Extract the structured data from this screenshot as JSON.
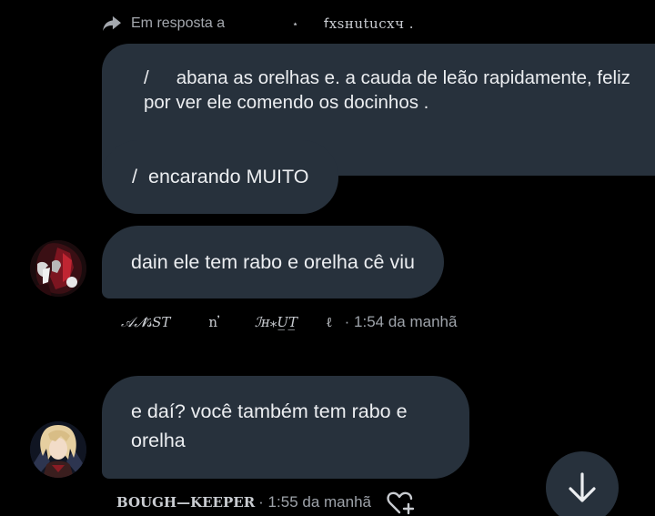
{
  "reply_header": {
    "label": "Em resposta a",
    "star": "⋆",
    "name": "ꬵxsʜutucxч ."
  },
  "messages": [
    {
      "slash": "/",
      "line1": "abana as orelhas e. a cauda de leão rapidamente, feliz",
      "line2": "por ver ele comendo os docinhos ."
    },
    {
      "slash": "/",
      "text": "encarando MUITO"
    },
    {
      "text": "dain ele tem rabo e orelha cê viu"
    },
    {
      "line1": "e daí? você também tem rabo e",
      "line2": "orelha"
    }
  ],
  "meta_1": {
    "seg1": "𝒜𝓝̈𝓈ST",
    "seg2": "n ̓",
    "seg3": "ℐʜ⁎U̲T̲",
    "seg4": "ℓ",
    "time": " · 1:54 da manhã"
  },
  "meta_2": {
    "name": "BOUGH—KEEPER",
    "time": " · 1:55 da manhã"
  },
  "icons": {
    "reply": "reply-arrow-icon",
    "heart_add": "heart-plus-icon",
    "scroll_down": "arrow-down-icon"
  },
  "colors": {
    "background": "#000000",
    "bubble": "#27313c",
    "meta_text": "#9ea3aa"
  }
}
